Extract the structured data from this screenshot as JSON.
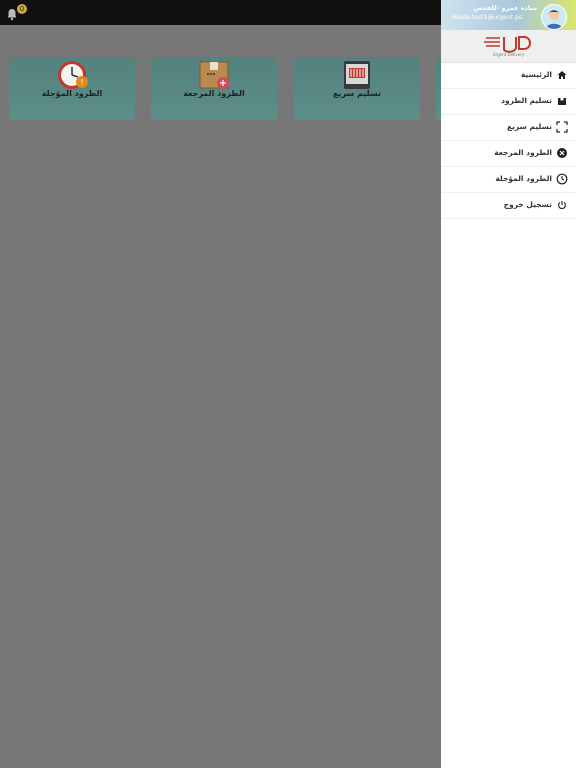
{
  "topbar": {
    "notification_icon": "bell-icon",
    "notification_count": "0"
  },
  "tiles": [
    {
      "label": "الطرود المؤجلة",
      "icon": "clock-icon"
    },
    {
      "label": "الطرود المرجعة",
      "icon": "box-return-icon"
    },
    {
      "label": "تسليم سريع",
      "icon": "barcode-scan-icon"
    }
  ],
  "drawer": {
    "user": {
      "name": "مبادة عمرو -للفحص",
      "email": "obada-test1@urgent.ps",
      "avatar_icon": "user-avatar-icon"
    },
    "logo_text": "Urgent Delivery",
    "menu": [
      {
        "label": "الرئيسية",
        "icon": "home-icon"
      },
      {
        "label": "تسليم الطرود",
        "icon": "package-icon"
      },
      {
        "label": "تسليم سريع",
        "icon": "scan-frame-icon"
      },
      {
        "label": "الطرود المرجعة",
        "icon": "close-circle-icon"
      },
      {
        "label": "الطرود المؤجلة",
        "icon": "clock-icon"
      },
      {
        "label": "تسجيل خروج",
        "icon": "power-icon"
      }
    ]
  },
  "colors": {
    "overlay": "#777777",
    "tile": "#5a8a86",
    "topbar": "#111111",
    "drawer_bg": "#ffffff"
  }
}
